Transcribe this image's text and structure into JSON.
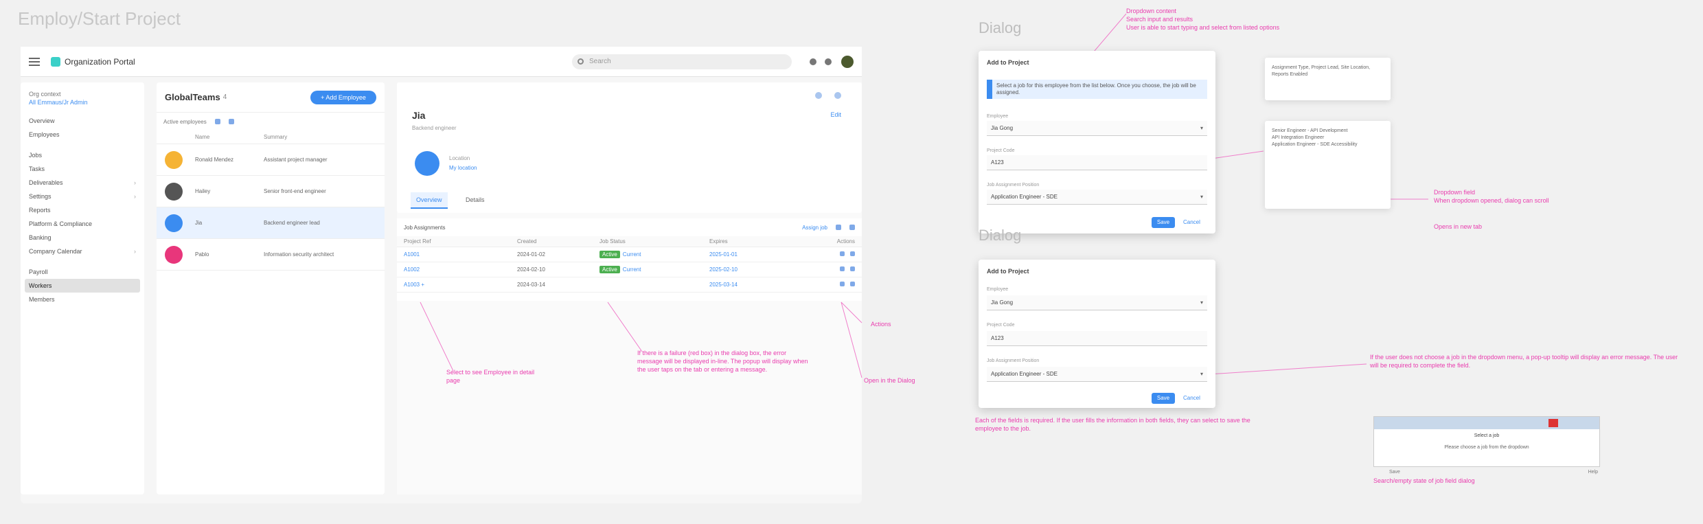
{
  "canvas": {
    "title": "Employ/Start Project"
  },
  "app": {
    "org": "Organization Portal",
    "search_placeholder": "Search",
    "sidenav": {
      "context": "Org context",
      "context_link": "All Emmaus/Jr Admin",
      "items": [
        "Overview",
        "Employees",
        "Jobs",
        "Tasks",
        "Deliverables",
        "Settings",
        "Reports",
        "Platform & Compliance",
        "Banking",
        "Company Calendar",
        "Payroll",
        "Workers",
        "Members"
      ]
    },
    "list": {
      "title": "GlobalTeams",
      "count": "4",
      "button": "+ Add Employee",
      "sub": "Active employees",
      "cols": [
        "",
        "Name",
        "Summary"
      ],
      "rows": [
        {
          "name": "Ronald Mendez",
          "desc": "Assistant project manager",
          "color": "#f5b335"
        },
        {
          "name": "Hailey",
          "desc": "Senior front-end engineer",
          "color": "#555555"
        },
        {
          "name": "Jia",
          "desc": "Backend engineer lead",
          "color": "#3b8cf0"
        },
        {
          "name": "Pablo",
          "desc": "Information security architect",
          "color": "#e8367b"
        }
      ]
    },
    "detail": {
      "title": "Jia",
      "subtitle": "Backend engineer",
      "link": "Edit",
      "kv_label": "Location",
      "kv_value": "My location",
      "tabs": [
        "Overview",
        "Details"
      ],
      "grid": {
        "title": "Job Assignments",
        "link": "Assign job",
        "cols": [
          "Project Ref",
          "Created",
          "Job Status",
          "Expires",
          "Actions"
        ],
        "rows": [
          {
            "ref": "A1001",
            "created": "2024-01-02",
            "status": "Active",
            "status2": "Current",
            "expires": "2025-01-01"
          },
          {
            "ref": "A1002",
            "created": "2024-02-10",
            "status": "Active",
            "status2": "Current",
            "expires": "2025-02-10"
          },
          {
            "ref": "A1003 +",
            "created": "2024-03-14",
            "status": "",
            "status2": "",
            "expires": "2025-03-14"
          }
        ]
      }
    }
  },
  "annotations": {
    "n1": "Select to see Employee in detail page",
    "n2": "If there is a failure (red box) in the dialog box, the error message will be displayed in-line. The popup will display when the user taps on the tab or entering a message.",
    "n3": "Open in the Dialog",
    "n4": "Actions",
    "n5": "Dropdown content\nSearch input and results\nUser is able to start typing and select from listed options",
    "n6": "Dropdown field\nWhen dropdown opened, dialog can scroll",
    "n7": "Opens in new tab",
    "n8": "Each of the fields is required. If the user fills the information in both fields, they can select to save the employee to the job.",
    "n9": "If the user does not choose a job in the dropdown menu, a pop-up tooltip will display an error message. The user will be required to complete the field.",
    "n10": "Search/empty state of job field dialog"
  },
  "dialogs": {
    "section1": "Dialog",
    "section2": "Dialog",
    "d1": {
      "title": "Add to Project",
      "info": "Select a job for this employee from the list below. Once you choose, the job will be assigned.",
      "label1": "Employee",
      "value1": "Jia Gong",
      "label2": "Project Code",
      "value2": "A123",
      "label3": "Job Assignment Position",
      "value3": "Application Engineer - SDE",
      "ok": "Save",
      "cancel": "Cancel"
    },
    "d2": {
      "title": "Add to Project",
      "label1": "Employee",
      "value1": "Jia Gong",
      "label2": "Project Code",
      "value2": "A123",
      "label3": "Job Assignment Position",
      "value3": "Application Engineer - SDE",
      "ok": "Save",
      "cancel": "Cancel"
    },
    "pop1": "Assignment Type, Project Lead, Site Location, Reports Enabled",
    "pop2": "Senior Engineer - API Development\nAPI Integration Engineer\nApplication Engineer - SDE Accessibility",
    "mini_head": "Select a job",
    "mini_body": "Please choose a job from the dropdown",
    "mini_left": "Save",
    "mini_right": "Help"
  },
  "colors": {
    "accent": "#3b8cf0",
    "annotation": "#e93cae",
    "success": "#4caf50"
  }
}
